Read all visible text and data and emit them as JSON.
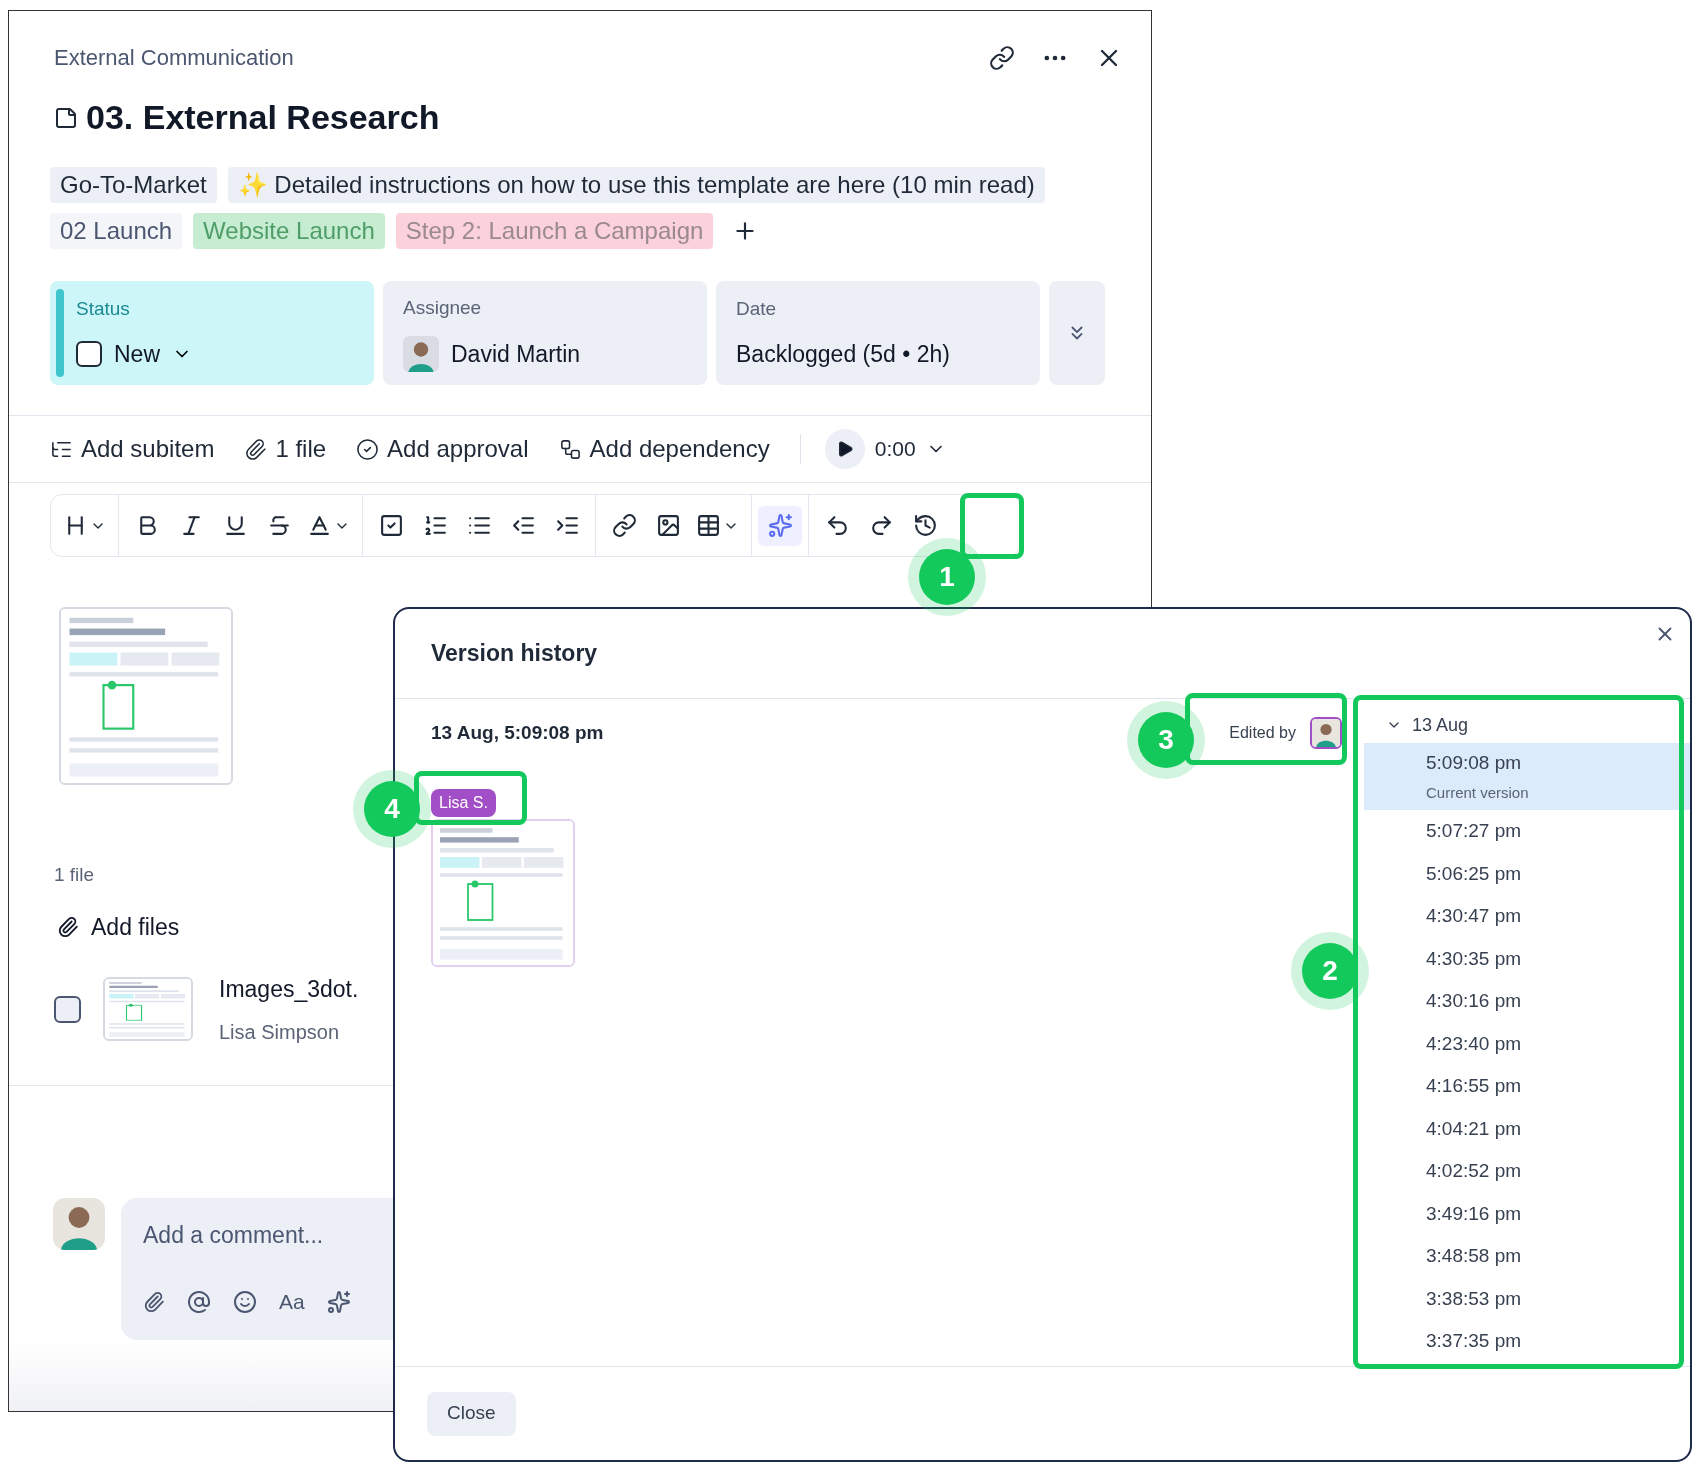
{
  "task": {
    "breadcrumb": "External Communication",
    "title": "03. External Research",
    "tag_rows": [
      [
        {
          "label": "Go-To-Market",
          "kind": "plain"
        },
        {
          "label": "✨ Detailed instructions on how to use this template are here (10 min read)",
          "kind": "plain"
        }
      ],
      [
        {
          "label": "02 Launch",
          "kind": "faint"
        },
        {
          "label": "Website Launch",
          "kind": "green"
        },
        {
          "label": "Step 2: Launch a Campaign",
          "kind": "pink"
        }
      ]
    ],
    "fields": [
      {
        "label": "Status",
        "value": "New",
        "kind": "status",
        "checked": false
      },
      {
        "label": "Assignee",
        "value": "David Martin",
        "kind": "person"
      },
      {
        "label": "Date",
        "value": "Backlogged (5d • 2h)",
        "kind": "text"
      }
    ],
    "actions": [
      {
        "label": "Add subitem",
        "kind": "subitem"
      },
      {
        "label": "1 file",
        "kind": "attach"
      },
      {
        "label": "Add approval",
        "kind": "approval"
      },
      {
        "label": "Add dependency",
        "kind": "dependency"
      }
    ],
    "timer": "0:00",
    "files_count": "1 file",
    "add_files": "Add files",
    "file": {
      "name": "Images_3dot.",
      "owner": "Lisa Simpson",
      "checked": false
    },
    "comment": {
      "placeholder": "Add a comment...",
      "format_label": "Aa"
    }
  },
  "version_history": {
    "title": "Version history",
    "date": "13 Aug, 5:09:08 pm",
    "edited_by": "Edited by",
    "author_tag": "Lisa S.",
    "group": {
      "label": "13 Aug",
      "expanded": true,
      "versions": [
        {
          "time": "5:09:08 pm",
          "note": "Current version",
          "selected": true
        },
        {
          "time": "5:07:27 pm",
          "selected": false
        },
        {
          "time": "5:06:25 pm",
          "selected": false
        },
        {
          "time": "4:30:47 pm",
          "selected": false
        },
        {
          "time": "4:30:35 pm",
          "selected": false
        },
        {
          "time": "4:30:16 pm",
          "selected": false
        },
        {
          "time": "4:23:40 pm",
          "selected": false
        },
        {
          "time": "4:16:55 pm",
          "selected": false
        },
        {
          "time": "4:04:21 pm",
          "selected": false
        },
        {
          "time": "4:02:52 pm",
          "selected": false
        },
        {
          "time": "3:49:16 pm",
          "selected": false
        },
        {
          "time": "3:48:58 pm",
          "selected": false
        },
        {
          "time": "3:38:53 pm",
          "selected": false
        },
        {
          "time": "3:37:35 pm",
          "selected": false
        }
      ]
    },
    "close": "Close"
  },
  "callouts": [
    "1",
    "2",
    "3",
    "4"
  ]
}
